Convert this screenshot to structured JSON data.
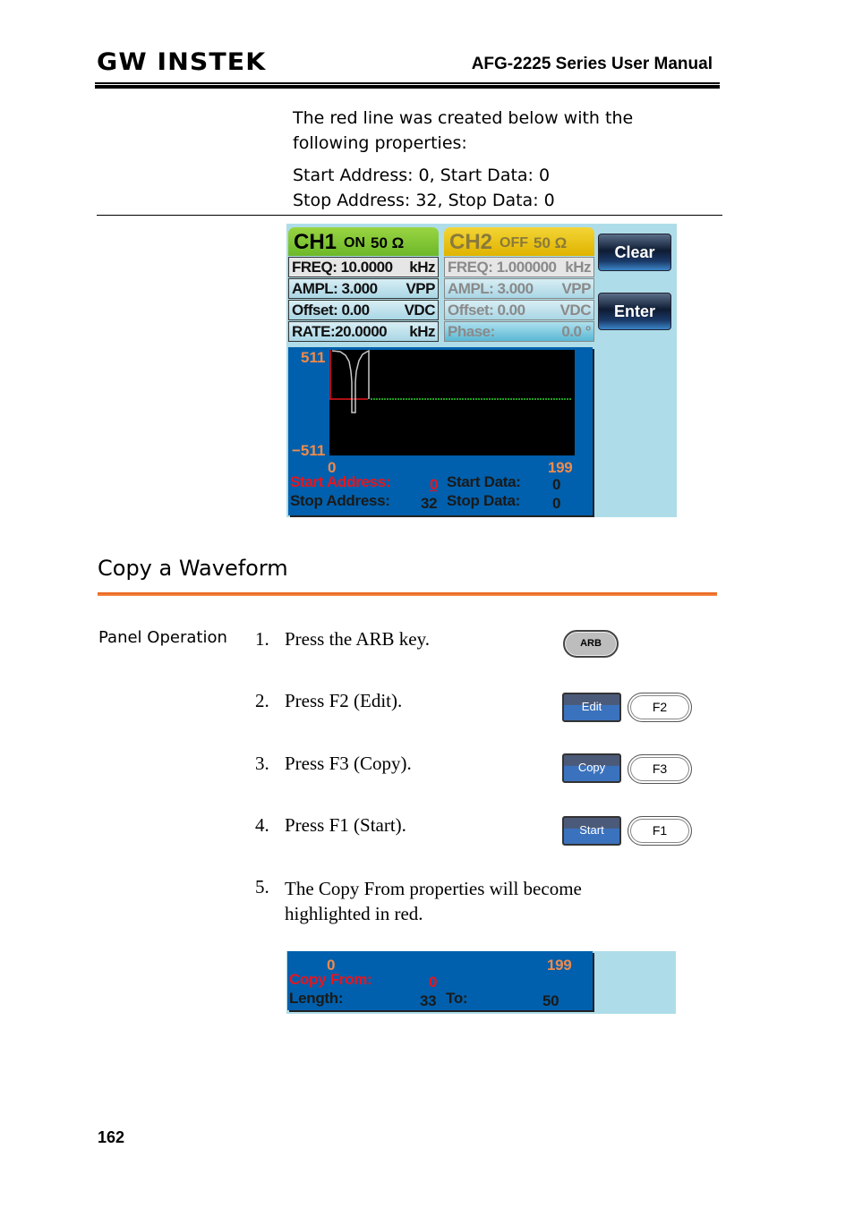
{
  "header": {
    "logo": "GW INSTEK",
    "manual_title": "AFG-2225 Series User Manual"
  },
  "intro": {
    "text": "The red line was created below with the following properties:",
    "line1": "Start Address: 0, Start Data: 0",
    "line2": "Stop Address: 32, Stop Data: 0"
  },
  "screen": {
    "ch1": {
      "name": "CH1",
      "state": "ON",
      "impedance": "50 Ω",
      "rows": [
        {
          "label": "FREQ: 10.0000",
          "unit": "kHz"
        },
        {
          "label": "AMPL:  3.000",
          "unit": "VPP"
        },
        {
          "label": "Offset:   0.00",
          "unit": "VDC"
        },
        {
          "label": "RATE:20.0000",
          "unit": "kHz"
        }
      ]
    },
    "ch2": {
      "name": "CH2",
      "state": "OFF",
      "impedance": "50 Ω",
      "rows": [
        {
          "label": "FREQ: 1.000000",
          "unit": "kHz"
        },
        {
          "label": "AMPL:  3.000",
          "unit": "VPP"
        },
        {
          "label": "Offset:   0.00",
          "unit": "VDC"
        },
        {
          "label": "Phase:",
          "unit": "0.0 °"
        }
      ]
    },
    "buttons": {
      "clear": "Clear",
      "enter": "Enter"
    },
    "waveform": {
      "y_max": "511",
      "y_min": "−511",
      "x_min": "0",
      "x_max": "199",
      "colors": {
        "edited_line": "#e8141e",
        "baseline": "#2bd12b",
        "waveform": "#c8c8c8"
      }
    },
    "fields": {
      "start_address_label": "Start Address:",
      "start_address_value": "0",
      "start_data_label": "Start Data:",
      "start_data_value": "0",
      "stop_address_label": "Stop Address:",
      "stop_address_value": "32",
      "stop_data_label": "Stop Data:",
      "stop_data_value": "0"
    }
  },
  "section": {
    "title": "Copy a Waveform",
    "panel_operation": "Panel Operation",
    "steps": [
      {
        "num": "1.",
        "text": "Press the ARB key."
      },
      {
        "num": "2.",
        "text": "Press F2 (Edit)."
      },
      {
        "num": "3.",
        "text": "Press F3 (Copy)."
      },
      {
        "num": "4.",
        "text": "Press F1 (Start)."
      },
      {
        "num": "5.",
        "text": "The Copy From properties will become highlighted in red."
      }
    ],
    "keys": {
      "arb": "ARB",
      "edit": "Edit",
      "f2": "F2",
      "copy": "Copy",
      "f3": "F3",
      "start": "Start",
      "f1": "F1"
    }
  },
  "copy_screen": {
    "x_min": "0",
    "x_max": "199",
    "copy_from_label": "Copy From:",
    "copy_from_value": "0",
    "length_label": "Length:",
    "length_value": "33",
    "to_label": "To:",
    "to_value": "50"
  },
  "footer": {
    "page_number": "162"
  }
}
